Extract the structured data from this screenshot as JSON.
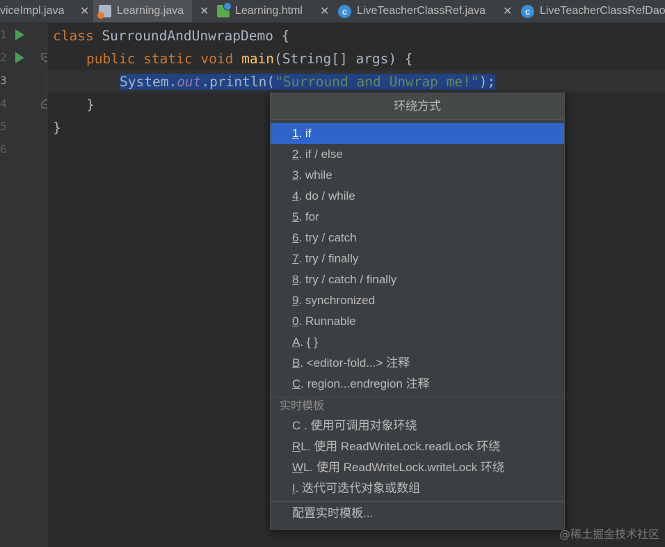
{
  "tabs": [
    {
      "label": "viceImpl.java",
      "icon": "java-file-icon",
      "active": false,
      "closable": true
    },
    {
      "label": "Learning.java",
      "icon": "java-file-icon",
      "active": true,
      "closable": true
    },
    {
      "label": "Learning.html",
      "icon": "html-file-icon",
      "active": false,
      "closable": true
    },
    {
      "label": "LiveTeacherClassRef.java",
      "icon": "java-class-icon",
      "active": false,
      "closable": true
    },
    {
      "label": "LiveTeacherClassRefDao",
      "icon": "java-class-icon",
      "active": false,
      "closable": false
    }
  ],
  "gutter": {
    "line_numbers": [
      "1",
      "2",
      "3",
      "4",
      "5",
      "6"
    ],
    "current_line": "3"
  },
  "code": {
    "line1": {
      "kw": "class",
      "rest": " SurroundAndUnwrapDemo {"
    },
    "line2": {
      "kw": "public static void",
      "sp": " ",
      "fn": "main",
      "rest": "(String[] args) {"
    },
    "line3": {
      "a": "System.",
      "field": "out",
      "b": ".println(",
      "str": "\"Surround and Unwrap me!\"",
      "c": ");"
    },
    "line4": "}",
    "line5": "}"
  },
  "popup": {
    "title": "环绕方式",
    "items": [
      {
        "mnemonic": "1",
        "label": ". if",
        "selected": true
      },
      {
        "mnemonic": "2",
        "label": ". if / else"
      },
      {
        "mnemonic": "3",
        "label": ". while"
      },
      {
        "mnemonic": "4",
        "label": ". do / while"
      },
      {
        "mnemonic": "5",
        "label": ". for"
      },
      {
        "mnemonic": "6",
        "label": ". try / catch"
      },
      {
        "mnemonic": "7",
        "label": ". try / finally"
      },
      {
        "mnemonic": "8",
        "label": ". try / catch / finally"
      },
      {
        "mnemonic": "9",
        "label": ". synchronized"
      },
      {
        "mnemonic": "0",
        "label": ". Runnable"
      },
      {
        "mnemonic": "A",
        "label": ". { }"
      },
      {
        "mnemonic": "B",
        "label": ". <editor-fold...> 注释"
      },
      {
        "mnemonic": "C",
        "label": ". region...endregion 注释"
      }
    ],
    "group_label": "实时模板",
    "template_items": [
      {
        "mnemonic": "",
        "label": "C . 使用可调用对象环绕"
      },
      {
        "mnemonic": "R",
        "label": "L. 使用 ReadWriteLock.readLock 环绕"
      },
      {
        "mnemonic": "W",
        "label": "L. 使用 ReadWriteLock.writeLock 环绕"
      },
      {
        "mnemonic": "I",
        "label": ". 迭代可迭代对象或数组"
      }
    ],
    "footer": "配置实时模板..."
  },
  "watermark": "@稀土掘金技术社区",
  "colors": {
    "selected_item": "#2f65ca",
    "selection": "#214283",
    "keyword": "#cc7832",
    "function": "#ffc66d",
    "string": "#6a8759",
    "field": "#9876aa",
    "run_icon": "#499c54"
  }
}
